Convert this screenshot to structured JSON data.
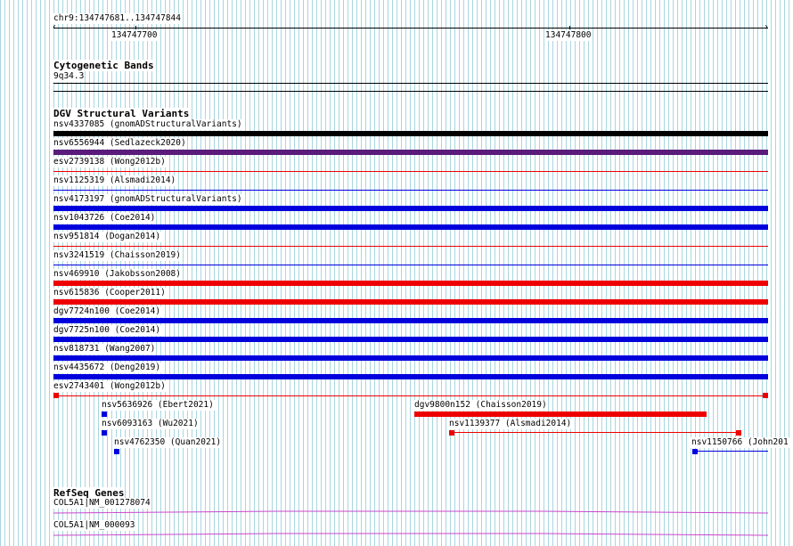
{
  "ruler": {
    "region": "chr9:134747681..134747844",
    "ticks": [
      "134747700",
      "134747800"
    ]
  },
  "cytoband": {
    "title": "Cytogenetic Bands",
    "band": "9q34.3"
  },
  "dgv": {
    "title": "DGV Structural Variants",
    "colors": {
      "black": "#000000",
      "purple": "#5a1b7a",
      "red": "#ee0000",
      "blue": "#0000dd"
    },
    "full_rows": [
      {
        "label": "nsv4337085 (gnomADStructuralVariants)",
        "color": "black",
        "thickness": "thick"
      },
      {
        "label": "nsv6556944 (Sedlazeck2020)",
        "color": "purple",
        "thickness": "thick"
      },
      {
        "label": "esv2739138 (Wong2012b)",
        "color": "red",
        "thickness": "thin"
      },
      {
        "label": "nsv1125319 (Alsmadi2014)",
        "color": "blue",
        "thickness": "thin"
      },
      {
        "label": "nsv4173197 (gnomADStructuralVariants)",
        "color": "blue",
        "thickness": "thick"
      },
      {
        "label": "nsv1043726 (Coe2014)",
        "color": "blue",
        "thickness": "thick"
      },
      {
        "label": "nsv951814 (Dogan2014)",
        "color": "red",
        "thickness": "thin"
      },
      {
        "label": "nsv3241519 (Chaisson2019)",
        "color": "blue",
        "thickness": "thin"
      },
      {
        "label": "nsv469910 (Jakobsson2008)",
        "color": "red",
        "thickness": "thick"
      },
      {
        "label": "nsv615836 (Cooper2011)",
        "color": "red",
        "thickness": "thick"
      },
      {
        "label": "dgv7724n100 (Coe2014)",
        "color": "blue",
        "thickness": "thick"
      },
      {
        "label": "dgv7725n100 (Coe2014)",
        "color": "blue",
        "thickness": "thick"
      },
      {
        "label": "nsv818731 (Wang2007)",
        "color": "blue",
        "thickness": "thick"
      },
      {
        "label": "nsv4435672 (Deng2019)",
        "color": "blue",
        "thickness": "thick"
      },
      {
        "label": "esv2743401 (Wong2012b)",
        "color": "red",
        "thickness": "thin-ends"
      }
    ],
    "partial": {
      "nsv5636926": "nsv5636926 (Ebert2021)",
      "nsv6093163": "nsv6093163 (Wu2021)",
      "nsv4762350": "nsv4762350 (Quan2021)",
      "dgv9800n152": "dgv9800n152 (Chaisson2019)",
      "nsv1139377": "nsv1139377 (Alsmadi2014)",
      "nsv1150766": "nsv1150766 (John201"
    }
  },
  "refseq": {
    "title": "RefSeq Genes",
    "gene_color": "#cc44cc",
    "genes": [
      "COL5A1|NM_001278074",
      "COL5A1|NM_000093"
    ]
  }
}
